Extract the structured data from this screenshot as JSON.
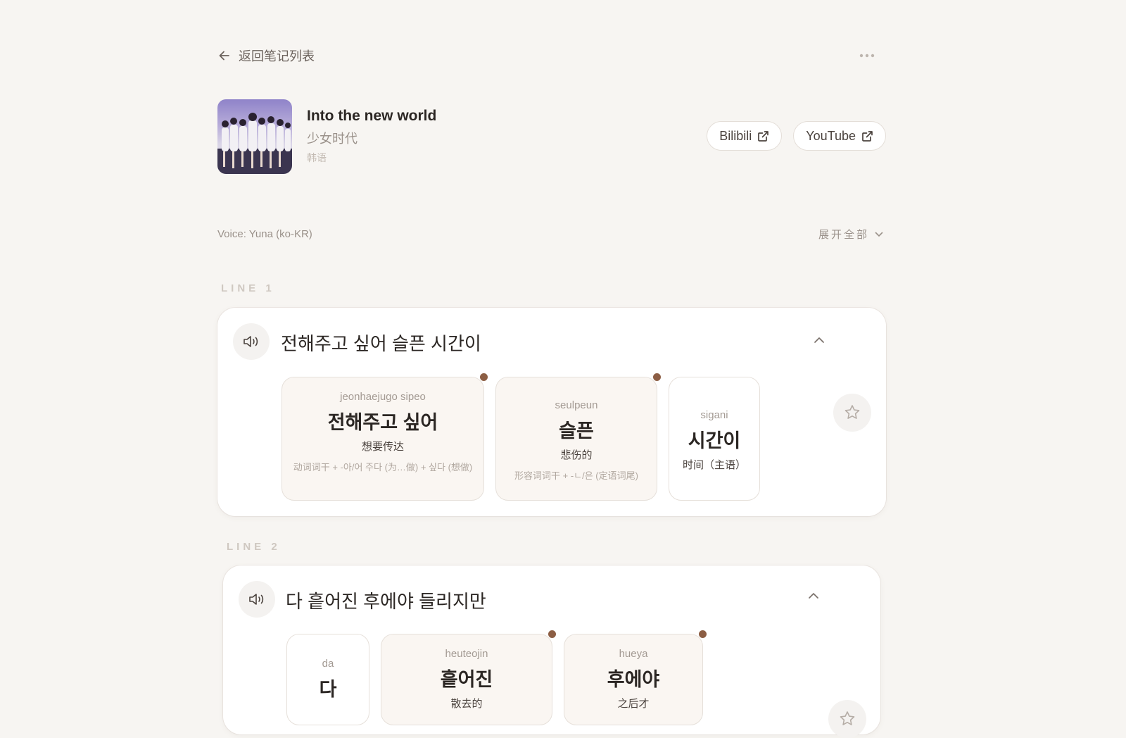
{
  "topbar": {
    "back_label": "返回笔记列表"
  },
  "song": {
    "title": "Into the new world",
    "artist": "少女时代",
    "language": "韩语",
    "links": [
      {
        "label": "Bilibili"
      },
      {
        "label": "YouTube"
      }
    ]
  },
  "controls": {
    "voice": "Voice: Yuna (ko-KR)",
    "expand_all": "展开全部"
  },
  "colors": {
    "background": "#f7f5f2",
    "accent_dot": "#8c5e44",
    "tinted_card": "#faf6f2"
  },
  "lines": [
    {
      "label": "LINE 1",
      "text": "전해주고 싶어 슬픈 시간이",
      "words": [
        {
          "roman": "jeonhaejugo sipeo",
          "hangul": "전해주고 싶어",
          "meaning": "想要传达",
          "grammar": "动词词干 + -아/어 주다 (为…做) + 싶다 (想做)",
          "marked": true
        },
        {
          "roman": "seulpeun",
          "hangul": "슬픈",
          "meaning": "悲伤的",
          "grammar": "形容词词干 + -ㄴ/은 (定语词尾)",
          "marked": true
        },
        {
          "roman": "sigani",
          "hangul": "시간이",
          "meaning": "时间（主语）",
          "grammar": "",
          "marked": false
        }
      ]
    },
    {
      "label": "LINE 2",
      "text": "다 흩어진 후에야 들리지만",
      "words": [
        {
          "roman": "da",
          "hangul": "다",
          "meaning": "",
          "grammar": "",
          "marked": false
        },
        {
          "roman": "heuteojin",
          "hangul": "흩어진",
          "meaning": "散去的",
          "grammar": "",
          "marked": true
        },
        {
          "roman": "hueya",
          "hangul": "후에야",
          "meaning": "之后才",
          "grammar": "",
          "marked": true
        }
      ]
    }
  ],
  "icons": [
    "arrow-left-icon",
    "more-horizontal-icon",
    "external-link-icon",
    "chevron-down-icon",
    "speaker-icon",
    "chevron-up-icon",
    "star-icon"
  ]
}
